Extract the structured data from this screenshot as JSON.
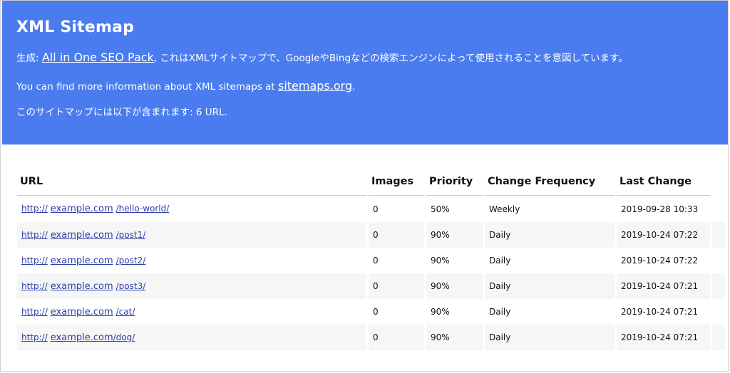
{
  "header": {
    "title": "XML Sitemap",
    "line1_prefix": "生成: ",
    "line1_link": "All in One SEO Pack",
    "line1_suffix": ", これはXMLサイトマップで、GoogleやBingなどの検索エンジンによって使用されることを意図しています。",
    "line2_prefix": "You can find more information about XML sitemaps at ",
    "line2_link": "sitemaps.org",
    "line2_suffix": ".",
    "line3": "このサイトマップには以下が含まれます: 6 URL."
  },
  "table": {
    "headers": [
      "URL",
      "Images",
      "Priority",
      "Change Frequency",
      "Last Change"
    ],
    "rows": [
      {
        "scheme": "http://",
        "host": "example.com",
        "path": "/hello-world/",
        "images": "0",
        "priority": "50%",
        "freq": "Weekly",
        "last": "2019-09-28 10:33"
      },
      {
        "scheme": "http://",
        "host": "example.com",
        "path": "/post1/",
        "images": "0",
        "priority": "90%",
        "freq": "Daily",
        "last": "2019-10-24 07:22"
      },
      {
        "scheme": "http://",
        "host": "example.com",
        "path": "/post2/",
        "images": "0",
        "priority": "90%",
        "freq": "Daily",
        "last": "2019-10-24 07:22"
      },
      {
        "scheme": "http://",
        "host": "example.com",
        "path": "/post3/",
        "images": "0",
        "priority": "90%",
        "freq": "Daily",
        "last": "2019-10-24 07:21"
      },
      {
        "scheme": "http://",
        "host": "example.com",
        "path": "/cat/",
        "images": "0",
        "priority": "90%",
        "freq": "Daily",
        "last": "2019-10-24 07:21"
      },
      {
        "scheme": "http://",
        "host": "example.com",
        "path": "/dog/",
        "images": "0",
        "priority": "90%",
        "freq": "Daily",
        "last": "2019-10-24 07:21"
      }
    ]
  },
  "colors": {
    "header_bg": "#4a7cf0",
    "link": "#2c3ea8",
    "row_alt": "#f6f6f6"
  }
}
